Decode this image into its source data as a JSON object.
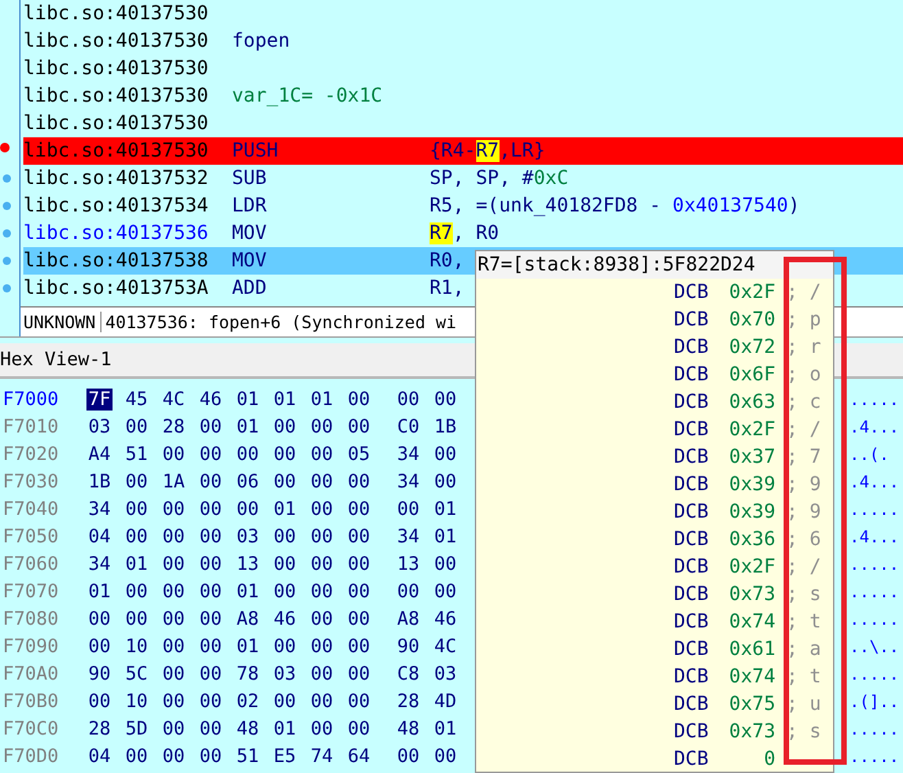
{
  "disassembly": {
    "rows": [
      {
        "kind": "plain",
        "address": "libc.so:40137530",
        "step": false,
        "breakpoint": false,
        "selected": false,
        "current": false
      },
      {
        "kind": "name",
        "address": "libc.so:40137530",
        "label": "fopen",
        "step": false,
        "breakpoint": false,
        "selected": false,
        "current": false
      },
      {
        "kind": "plain",
        "address": "libc.so:40137530",
        "step": false,
        "breakpoint": false,
        "selected": false,
        "current": false
      },
      {
        "kind": "variable",
        "address": "libc.so:40137530",
        "label": "var_1C= -0x1C",
        "step": false,
        "breakpoint": false,
        "selected": false,
        "current": false
      },
      {
        "kind": "plain",
        "address": "libc.so:40137530",
        "step": false,
        "breakpoint": false,
        "selected": false,
        "current": false
      },
      {
        "kind": "instruction",
        "address": "libc.so:40137530",
        "mnemonic": "PUSH",
        "operands": [
          {
            "t": "{R4-",
            "kind": "text"
          },
          {
            "t": "R7",
            "kind": "highlight"
          },
          {
            "t": ",LR}",
            "kind": "text"
          }
        ],
        "step": false,
        "breakpoint": true,
        "selected": false,
        "current": false
      },
      {
        "kind": "instruction",
        "address": "libc.so:40137532",
        "mnemonic": "SUB",
        "operands": [
          {
            "t": "SP, SP, #",
            "kind": "text"
          },
          {
            "t": "0xC",
            "kind": "number"
          }
        ],
        "step": true,
        "breakpoint": false,
        "selected": false,
        "current": false
      },
      {
        "kind": "instruction",
        "address": "libc.so:40137534",
        "mnemonic": "LDR",
        "operands": [
          {
            "t": "R5, =(unk_40182FD8 - ",
            "kind": "text"
          },
          {
            "t": "0x40137540",
            "kind": "address"
          },
          {
            "t": ")",
            "kind": "text"
          }
        ],
        "step": true,
        "breakpoint": false,
        "selected": false,
        "current": false
      },
      {
        "kind": "instruction",
        "address": "libc.so:40137536",
        "mnemonic": "MOV",
        "operands": [
          {
            "t": "R7",
            "kind": "highlight"
          },
          {
            "t": ", R0",
            "kind": "text"
          }
        ],
        "step": true,
        "breakpoint": false,
        "selected": false,
        "current": true
      },
      {
        "kind": "instruction",
        "address": "libc.so:40137538",
        "mnemonic": "MOV",
        "operands": [
          {
            "t": "R0,",
            "kind": "text"
          }
        ],
        "step": true,
        "breakpoint": false,
        "selected": true,
        "current": false
      },
      {
        "kind": "instruction",
        "address": "libc.so:4013753A",
        "mnemonic": "ADD",
        "operands": [
          {
            "t": "R1,",
            "kind": "text"
          }
        ],
        "step": true,
        "breakpoint": false,
        "selected": false,
        "current": false
      }
    ],
    "status": {
      "segment": "UNKNOWN",
      "location": "40137536: fopen+6 (Synchronized wi"
    }
  },
  "hex_view": {
    "title": "Hex View-1",
    "rows": [
      {
        "address": "F7000",
        "selected": true,
        "bytes": [
          "7F",
          "45",
          "4C",
          "46",
          "01",
          "01",
          "01",
          "00",
          "00",
          "00"
        ],
        "ascii": "....."
      },
      {
        "address": "F7010",
        "selected": false,
        "bytes": [
          "03",
          "00",
          "28",
          "00",
          "01",
          "00",
          "00",
          "00",
          "C0",
          "1B"
        ],
        "ascii": ".4..."
      },
      {
        "address": "F7020",
        "selected": false,
        "bytes": [
          "A4",
          "51",
          "00",
          "00",
          "00",
          "00",
          "00",
          "05",
          "34",
          "00"
        ],
        "ascii": "..(."
      },
      {
        "address": "F7030",
        "selected": false,
        "bytes": [
          "1B",
          "00",
          "1A",
          "00",
          "06",
          "00",
          "00",
          "00",
          "34",
          "00"
        ],
        "ascii": ".4..."
      },
      {
        "address": "F7040",
        "selected": false,
        "bytes": [
          "34",
          "00",
          "00",
          "00",
          "00",
          "01",
          "00",
          "00",
          "00",
          "01"
        ],
        "ascii": "....."
      },
      {
        "address": "F7050",
        "selected": false,
        "bytes": [
          "04",
          "00",
          "00",
          "00",
          "03",
          "00",
          "00",
          "00",
          "34",
          "01"
        ],
        "ascii": ".4..."
      },
      {
        "address": "F7060",
        "selected": false,
        "bytes": [
          "34",
          "01",
          "00",
          "00",
          "13",
          "00",
          "00",
          "00",
          "13",
          "00"
        ],
        "ascii": "....."
      },
      {
        "address": "F7070",
        "selected": false,
        "bytes": [
          "01",
          "00",
          "00",
          "00",
          "01",
          "00",
          "00",
          "00",
          "00",
          "00"
        ],
        "ascii": "....."
      },
      {
        "address": "F7080",
        "selected": false,
        "bytes": [
          "00",
          "00",
          "00",
          "00",
          "A8",
          "46",
          "00",
          "00",
          "A8",
          "46"
        ],
        "ascii": "....."
      },
      {
        "address": "F7090",
        "selected": false,
        "bytes": [
          "00",
          "10",
          "00",
          "00",
          "01",
          "00",
          "00",
          "00",
          "90",
          "4C"
        ],
        "ascii": "..\\.."
      },
      {
        "address": "F70A0",
        "selected": false,
        "bytes": [
          "90",
          "5C",
          "00",
          "00",
          "78",
          "03",
          "00",
          "00",
          "C8",
          "03"
        ],
        "ascii": "....."
      },
      {
        "address": "F70B0",
        "selected": false,
        "bytes": [
          "00",
          "10",
          "00",
          "00",
          "02",
          "00",
          "00",
          "00",
          "28",
          "4D"
        ],
        "ascii": ".(].."
      },
      {
        "address": "F70C0",
        "selected": false,
        "bytes": [
          "28",
          "5D",
          "00",
          "00",
          "48",
          "01",
          "00",
          "00",
          "48",
          "01"
        ],
        "ascii": "....."
      },
      {
        "address": "F70D0",
        "selected": false,
        "bytes": [
          "04",
          "00",
          "00",
          "00",
          "51",
          "E5",
          "74",
          "64",
          "00",
          "00"
        ],
        "ascii": "....."
      }
    ]
  },
  "hint": {
    "header": "R7=[stack:8938]:5F822D24",
    "rows": [
      {
        "directive": "DCB",
        "value": "0x2F",
        "comment": "; /"
      },
      {
        "directive": "DCB",
        "value": "0x70",
        "comment": "; p"
      },
      {
        "directive": "DCB",
        "value": "0x72",
        "comment": "; r"
      },
      {
        "directive": "DCB",
        "value": "0x6F",
        "comment": "; o"
      },
      {
        "directive": "DCB",
        "value": "0x63",
        "comment": "; c"
      },
      {
        "directive": "DCB",
        "value": "0x2F",
        "comment": "; /"
      },
      {
        "directive": "DCB",
        "value": "0x37",
        "comment": "; 7"
      },
      {
        "directive": "DCB",
        "value": "0x39",
        "comment": "; 9"
      },
      {
        "directive": "DCB",
        "value": "0x39",
        "comment": "; 9"
      },
      {
        "directive": "DCB",
        "value": "0x36",
        "comment": "; 6"
      },
      {
        "directive": "DCB",
        "value": "0x2F",
        "comment": "; /"
      },
      {
        "directive": "DCB",
        "value": "0x73",
        "comment": "; s"
      },
      {
        "directive": "DCB",
        "value": "0x74",
        "comment": "; t"
      },
      {
        "directive": "DCB",
        "value": "0x61",
        "comment": "; a"
      },
      {
        "directive": "DCB",
        "value": "0x74",
        "comment": "; t"
      },
      {
        "directive": "DCB",
        "value": "0x75",
        "comment": "; u"
      },
      {
        "directive": "DCB",
        "value": "0x73",
        "comment": "; s"
      },
      {
        "directive": "DCB",
        "value": "0",
        "comment": ""
      }
    ]
  }
}
